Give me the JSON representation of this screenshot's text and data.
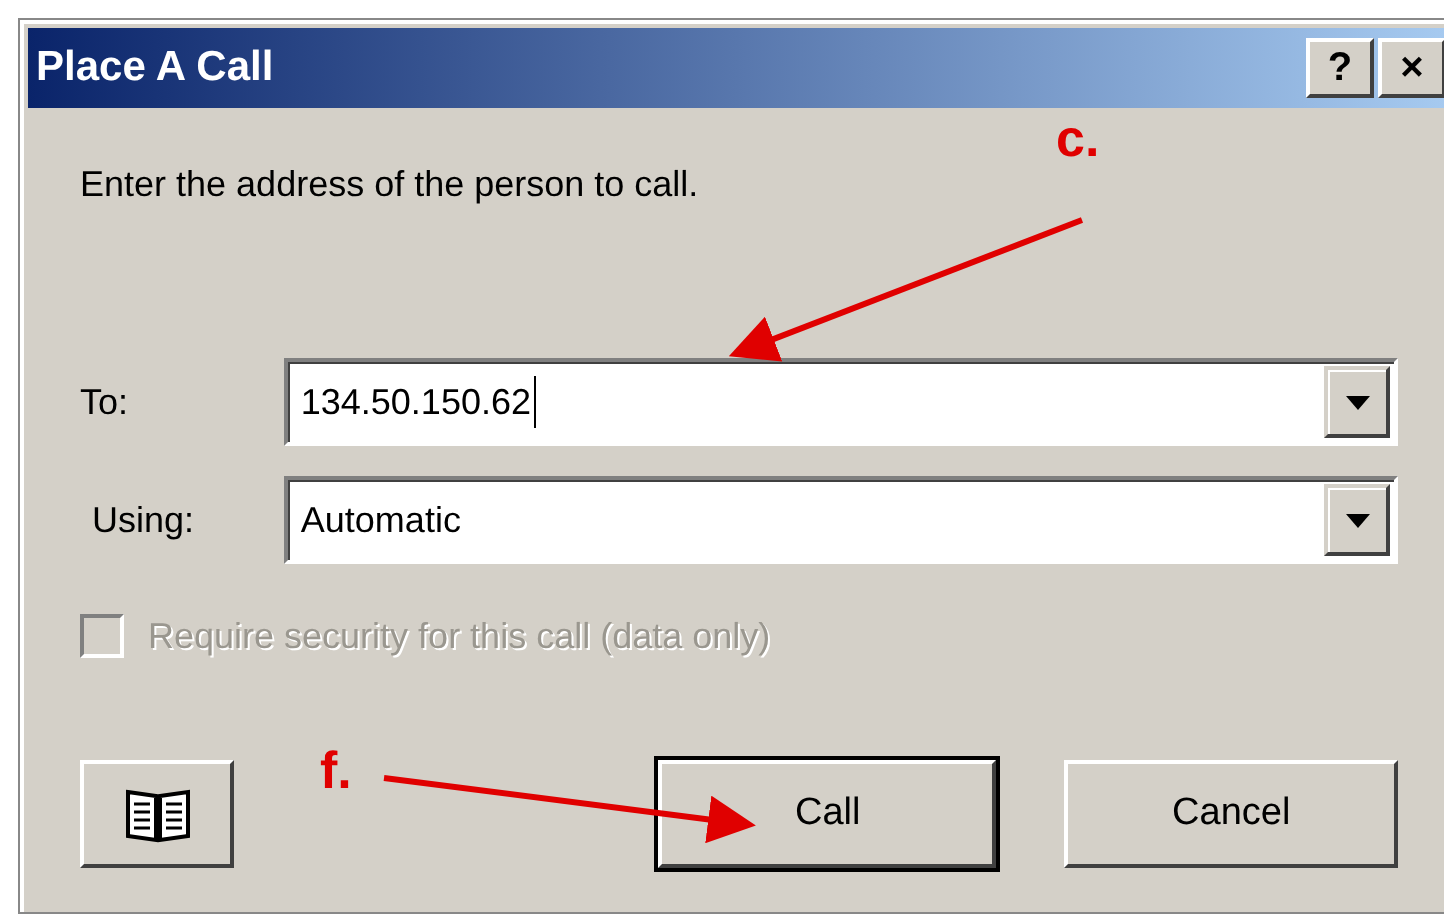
{
  "window": {
    "title": "Place A Call",
    "title_buttons": [
      "?",
      "×"
    ]
  },
  "instruction": "Enter the address of the person to call.",
  "fields": [
    {
      "label": "To:",
      "value": "134.50.150.62",
      "focused": true
    },
    {
      "label": "Using:",
      "value": "Automatic",
      "focused": false
    }
  ],
  "checkbox": {
    "label": "Require security for this call (data only)",
    "checked": false,
    "disabled": true
  },
  "buttons": [
    {
      "kind": "icon",
      "default": false
    },
    {
      "kind": "text",
      "label": "Call",
      "default": true
    },
    {
      "kind": "text",
      "label": "Cancel",
      "default": false
    }
  ],
  "annotations": [
    {
      "label": "c."
    },
    {
      "label": "f."
    }
  ]
}
